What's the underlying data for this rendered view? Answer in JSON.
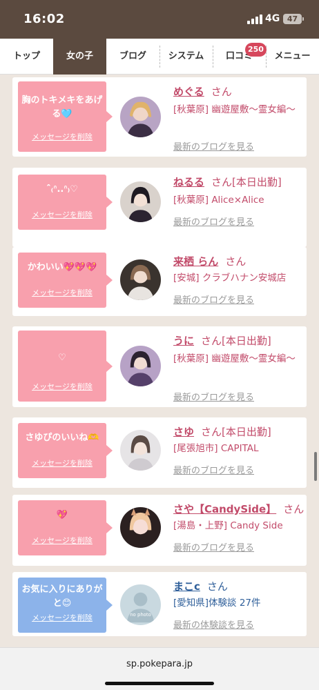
{
  "status": {
    "time": "16:02",
    "network": "4G",
    "battery": "47"
  },
  "nav": {
    "tabs": [
      "トップ",
      "女の子",
      "ブログ",
      "システム",
      "口コミ",
      "メニュー"
    ],
    "active_index": 1,
    "review_badge": "250"
  },
  "delete_label": "メッセージを削除",
  "san_label": "さん",
  "cards": [
    {
      "message": "胸のトキメキをあげる🩵",
      "name": "めぐる",
      "status": "",
      "shop": "[秋葉原] 幽遊屋敷〜霊女編〜",
      "link": "最新のブログを見る"
    },
    {
      "message": "ˆ̑‎₍ᐢ..ᐢ₎♡",
      "name": "ねるる",
      "status": "[本日出勤]",
      "shop": "[秋葉原] Alice×Alice",
      "link": "最新のブログを見る"
    },
    {
      "message": "かわいい💖💖💖",
      "name": "来栖 らん",
      "status": "",
      "shop": "[安城] クラブハナン安城店",
      "link": "最新のブログを見る"
    },
    {
      "message": "♡",
      "name": "うに",
      "status": "[本日出勤]",
      "shop": "[秋葉原] 幽遊屋敷〜霊女編〜",
      "link": "最新のブログを見る"
    },
    {
      "message": "さゆぴのいいね🫶",
      "name": "さゆ",
      "status": "[本日出勤]",
      "shop": "[尾張旭市] CAPITAL",
      "link": "最新のブログを見る"
    },
    {
      "message": "💖",
      "name": "さや【CandySide】",
      "status": "",
      "shop": "[湯島・上野] Candy Side",
      "link": "最新のブログを見る"
    },
    {
      "message": "お気に入りにありがと😊",
      "name": "まこc",
      "status": "",
      "shop": "[愛知県]体験談 27件",
      "link": "最新の体験談を見る",
      "avatar_text": "no photo"
    }
  ],
  "url": "sp.pokepara.jp"
}
